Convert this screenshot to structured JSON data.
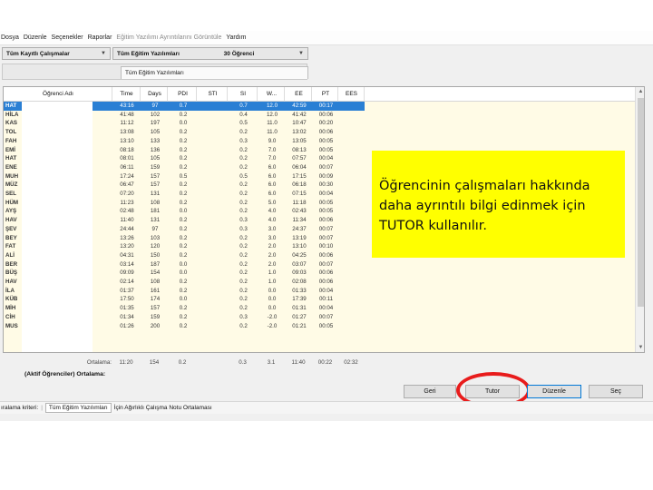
{
  "menu": {
    "items": [
      "Dosya",
      "Düzenle",
      "Seçenekler",
      "Raporlar",
      "Eğitim Yazılımı Ayrıntılarını Görüntüle",
      "Yardım"
    ],
    "enabled": [
      true,
      true,
      true,
      true,
      false,
      true
    ]
  },
  "toolbar": {
    "scope": "Tüm Kayıtlı Çalışmalar",
    "software": "Tüm Eğitim Yazılımları",
    "count": "30 Öğrenci"
  },
  "subtab": {
    "label": "Tüm Eğitim Yazılımları"
  },
  "table": {
    "columns": [
      "Öğrenci Adı",
      "Time",
      "Days",
      "PDI",
      "STI",
      "SI",
      "W...",
      "EE",
      "PT",
      "EES"
    ],
    "rows": [
      [
        "HAT",
        "43:16",
        "97",
        "0.7",
        "",
        "0.7",
        "12.0",
        "42:59",
        "00:17",
        ""
      ],
      [
        "HİLA",
        "41:48",
        "102",
        "0.2",
        "",
        "0.4",
        "12.0",
        "41:42",
        "00:06",
        ""
      ],
      [
        "KAS",
        "11:12",
        "197",
        "0.0",
        "",
        "0.5",
        "11.0",
        "10:47",
        "00:20",
        ""
      ],
      [
        "TOL",
        "13:08",
        "105",
        "0.2",
        "",
        "0.2",
        "11.0",
        "13:02",
        "00:06",
        ""
      ],
      [
        "FAH",
        "13:10",
        "133",
        "0.2",
        "",
        "0.3",
        "9.0",
        "13:05",
        "00:05",
        ""
      ],
      [
        "EMİ",
        "08:18",
        "136",
        "0.2",
        "",
        "0.2",
        "7.0",
        "08:13",
        "00:05",
        ""
      ],
      [
        "HAT",
        "08:01",
        "105",
        "0.2",
        "",
        "0.2",
        "7.0",
        "07:57",
        "00:04",
        ""
      ],
      [
        "ENE",
        "06:11",
        "159",
        "0.2",
        "",
        "0.2",
        "6.0",
        "06:04",
        "00:07",
        ""
      ],
      [
        "MUH",
        "17:24",
        "157",
        "0.5",
        "",
        "0.5",
        "6.0",
        "17:15",
        "00:09",
        ""
      ],
      [
        "MÜZ",
        "06:47",
        "157",
        "0.2",
        "",
        "0.2",
        "6.0",
        "06:18",
        "00:30",
        ""
      ],
      [
        "SEL",
        "07:20",
        "131",
        "0.2",
        "",
        "0.2",
        "6.0",
        "07:15",
        "00:04",
        ""
      ],
      [
        "HÜM",
        "11:23",
        "108",
        "0.2",
        "",
        "0.2",
        "5.0",
        "11:18",
        "00:05",
        ""
      ],
      [
        "AYŞ",
        "02:48",
        "181",
        "0.0",
        "",
        "0.2",
        "4.0",
        "02:43",
        "00:05",
        ""
      ],
      [
        "HAV",
        "11:40",
        "131",
        "0.2",
        "",
        "0.3",
        "4.0",
        "11:34",
        "00:06",
        ""
      ],
      [
        "ŞEV",
        "24:44",
        "97",
        "0.2",
        "",
        "0.3",
        "3.0",
        "24:37",
        "00:07",
        ""
      ],
      [
        "BEY",
        "13:26",
        "103",
        "0.2",
        "",
        "0.2",
        "3.0",
        "13:19",
        "00:07",
        ""
      ],
      [
        "FAT",
        "13:20",
        "120",
        "0.2",
        "",
        "0.2",
        "2.0",
        "13:10",
        "00:10",
        ""
      ],
      [
        "ALİ",
        "04:31",
        "150",
        "0.2",
        "",
        "0.2",
        "2.0",
        "04:25",
        "00:06",
        ""
      ],
      [
        "BER",
        "03:14",
        "187",
        "0.0",
        "",
        "0.2",
        "2.0",
        "03:07",
        "00:07",
        ""
      ],
      [
        "BÜŞ",
        "09:09",
        "154",
        "0.0",
        "",
        "0.2",
        "1.0",
        "09:03",
        "00:06",
        ""
      ],
      [
        "HAV",
        "02:14",
        "108",
        "0.2",
        "",
        "0.2",
        "1.0",
        "02:08",
        "00:06",
        ""
      ],
      [
        "İLA",
        "01:37",
        "161",
        "0.2",
        "",
        "0.2",
        "0.0",
        "01:33",
        "00:04",
        ""
      ],
      [
        "KÜB",
        "17:50",
        "174",
        "0.0",
        "",
        "0.2",
        "0.0",
        "17:39",
        "00:11",
        ""
      ],
      [
        "MİH",
        "01:35",
        "157",
        "0.2",
        "",
        "0.2",
        "0.0",
        "01:31",
        "00:04",
        ""
      ],
      [
        "CİH",
        "01:34",
        "159",
        "0.2",
        "",
        "0.3",
        "-2.0",
        "01:27",
        "00:07",
        ""
      ],
      [
        "MUS",
        "01:26",
        "200",
        "0.2",
        "",
        "0.2",
        "-2.0",
        "01:21",
        "00:05",
        ""
      ]
    ]
  },
  "averages": {
    "label": "Ortalama:",
    "values": [
      "11:20",
      "154",
      "0.2",
      "",
      "0.3",
      "3.1",
      "11:40",
      "00:22",
      "02:32"
    ],
    "active_label": "(Aktif Öğrenciler) Ortalama:"
  },
  "buttons": {
    "back": "Geri",
    "tutor": "Tutor",
    "edit": "Düzenle",
    "exit": "Seç"
  },
  "status": {
    "label": "ıralama kriteri:",
    "combo": "Tüm Eğitim Yazılımları",
    "text_1": "İçin Ağırlıklı Çalışma Notu Ortalaması"
  },
  "note": {
    "text": "Öğrencinin çalışmaları hakkında daha ayrıntılı bilgi edinmek için TUTOR kullanılır."
  },
  "colors": {
    "selection": "#2a7fd4",
    "grid_bg": "#fffbe6",
    "note_bg": "#ffff00",
    "highlight_ring": "#e81c1c"
  }
}
